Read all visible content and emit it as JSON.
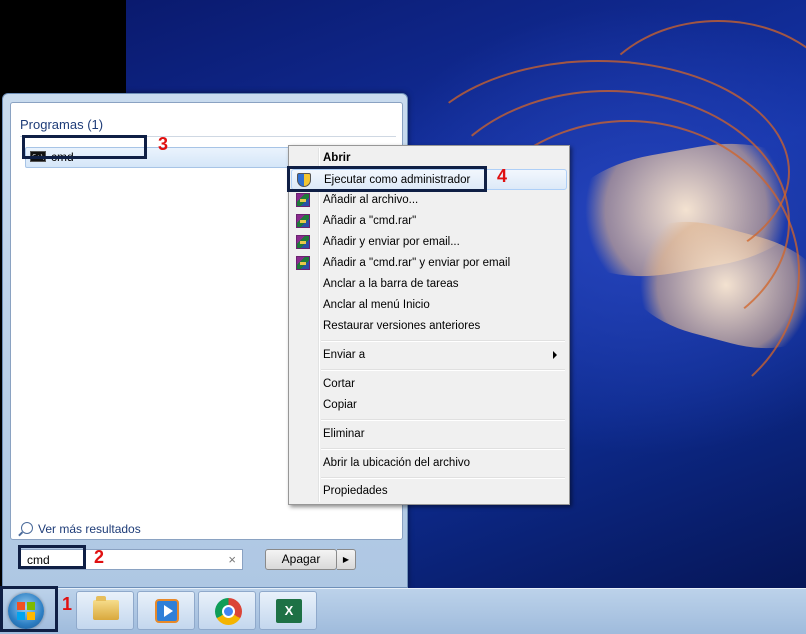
{
  "start_menu": {
    "section_title": "Programas (1)",
    "result_label": "cmd",
    "cmd_icon_text": "C:\\",
    "more_results": "Ver más resultados",
    "search_value": "cmd",
    "clear_glyph": "×",
    "shutdown_label": "Apagar",
    "shutdown_arrow": "▶"
  },
  "context_menu": {
    "items": [
      {
        "label": "Abrir",
        "icon": null
      },
      {
        "label": "Ejecutar como administrador",
        "icon": "shield-icon"
      },
      {
        "label": "Añadir al archivo...",
        "icon": "winrar-icon"
      },
      {
        "label": "Añadir a \"cmd.rar\"",
        "icon": "winrar-icon"
      },
      {
        "label": "Añadir y enviar por email...",
        "icon": "winrar-icon"
      },
      {
        "label": "Añadir a \"cmd.rar\" y enviar por email",
        "icon": "winrar-icon"
      },
      {
        "label": "Anclar a la barra de tareas",
        "icon": null
      },
      {
        "label": "Anclar al menú Inicio",
        "icon": null
      },
      {
        "label": "Restaurar versiones anteriores",
        "icon": null
      },
      {
        "label": "Enviar a",
        "icon": null,
        "submenu": true
      },
      {
        "label": "Cortar",
        "icon": null
      },
      {
        "label": "Copiar",
        "icon": null
      },
      {
        "label": "Eliminar",
        "icon": null
      },
      {
        "label": "Abrir la ubicación del archivo",
        "icon": null
      },
      {
        "label": "Propiedades",
        "icon": null
      }
    ]
  },
  "annotations": {
    "n1": "1",
    "n2": "2",
    "n3": "3",
    "n4": "4"
  },
  "taskbar": {
    "excel_letter": "X",
    "pinned": [
      "windows-explorer-icon",
      "windows-media-player-icon",
      "chrome-icon",
      "excel-icon"
    ]
  },
  "colors": {
    "annotation_red": "#e01010",
    "highlight_border": "#0f1f45",
    "accent_blue": "#1e3c78"
  }
}
